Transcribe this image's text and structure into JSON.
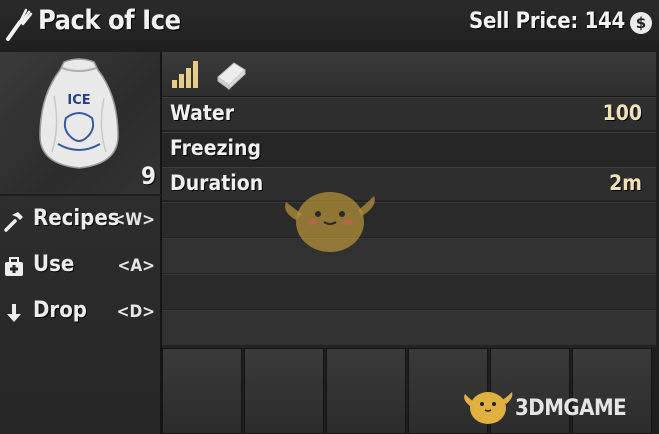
{
  "header": {
    "item_name": "Pack of Ice",
    "sell_price_text": "Sell Price: 144",
    "currency_symbol": "$",
    "item_icon": "fork-icon",
    "currency_icon": "coin-icon"
  },
  "preview": {
    "bag_text": "ICE",
    "count": "9"
  },
  "actions": [
    {
      "label": "Recipes",
      "key": "<W>",
      "icon": "hammer-icon"
    },
    {
      "label": "Use",
      "key": "<A>",
      "icon": "medkit-icon"
    },
    {
      "label": "Drop",
      "key": "<D>",
      "icon": "arrow-down-icon"
    }
  ],
  "tabs": [
    {
      "icon": "stats-bars-icon"
    },
    {
      "icon": "book-icon"
    }
  ],
  "stats": [
    {
      "label": "Water",
      "value": "100"
    },
    {
      "label": "Freezing",
      "value": ""
    },
    {
      "label": "Duration",
      "value": "2m"
    }
  ],
  "watermark": {
    "text": "3DMGAME"
  },
  "colors": {
    "value_accent": "#f0e2b6",
    "panel_bg": "#232323",
    "text": "#ededed"
  }
}
